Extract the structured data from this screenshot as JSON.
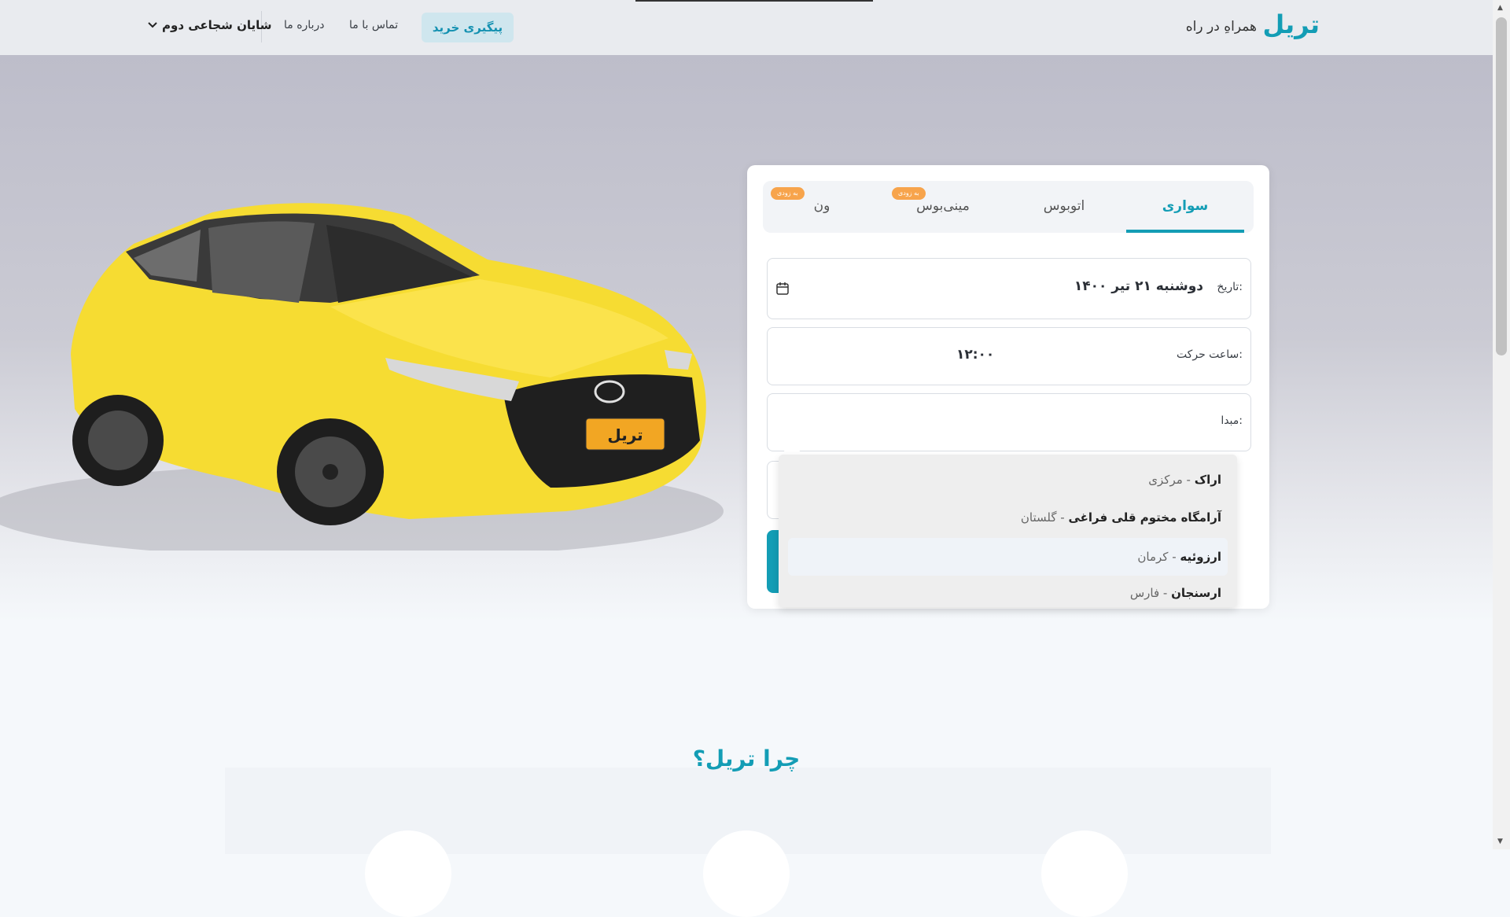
{
  "header": {
    "brand": "تریل",
    "slogan": "همراهِ در راه",
    "track_button": "پیگیری خرید",
    "contact": "تماس با ما",
    "about": "درباره ما",
    "user_name": "شایان شجاعی دوم"
  },
  "hero": {
    "plate_text": "تریل"
  },
  "search": {
    "tabs": [
      {
        "label": "سواری",
        "active": true
      },
      {
        "label": "اتوبوس",
        "active": false
      },
      {
        "label": "مینی‌بوس",
        "badge": "به زودی"
      },
      {
        "label": "ون",
        "badge": "به زودی"
      }
    ],
    "date_label": "تاریخ:",
    "date_value": "دوشنبه ۲۱ تیر ۱۴۰۰",
    "time_label": "ساعت حرکت:",
    "time_value": "۱۲:۰۰",
    "origin_label": "مبدا:",
    "dropdown": [
      {
        "city": "اراک",
        "province": "مرکزی"
      },
      {
        "city": "آرامگاه مختوم قلی فراغی",
        "province": "گلستان"
      },
      {
        "city": "ارزوئیه",
        "province": "کرمان"
      },
      {
        "city": "ارسنجان",
        "province": "فارس"
      }
    ]
  },
  "why": {
    "title": "چرا تریل؟"
  }
}
